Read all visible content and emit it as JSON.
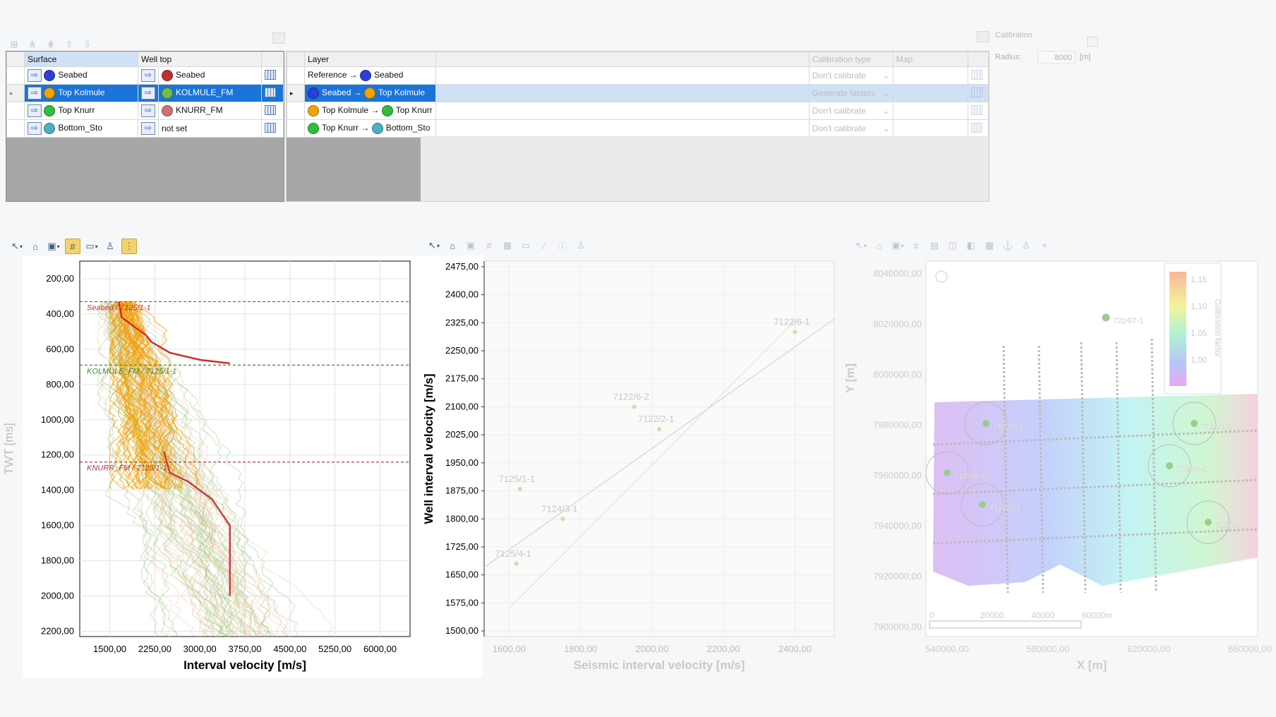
{
  "top_panel": {
    "calibration_label": "Calibration",
    "radius_label": "Radius:",
    "radius_value": "8000",
    "radius_unit": "[m]"
  },
  "surface_grid": {
    "headers": [
      "Surface",
      "Well top"
    ],
    "rows": [
      {
        "surface": "Seabed",
        "well_top": "Seabed",
        "surface_color": "#2d3fd8",
        "top_color": "#c03030"
      },
      {
        "surface": "Top Kolmule",
        "well_top": "KOLMULE_FM",
        "surface_color": "#f2a400",
        "top_color": "#6fbf4a"
      },
      {
        "surface": "Top Knurr",
        "well_top": "KNURR_FM",
        "surface_color": "#2fbf3a",
        "top_color": "#d07070"
      },
      {
        "surface": "Bottom_Sto",
        "well_top": "not set",
        "surface_color": "#4ab0c8",
        "top_color": ""
      }
    ]
  },
  "layer_grid": {
    "headers": [
      "Layer",
      "Calibration type",
      "Map"
    ],
    "rows": [
      {
        "from": "Reference",
        "to": "Seabed",
        "calibration": "Don't calibrate"
      },
      {
        "from": "Seabed",
        "to": "Top Kolmule",
        "calibration": "Generate factors"
      },
      {
        "from": "Top Kolmule",
        "to": "Top Knurr",
        "calibration": "Don't calibrate"
      },
      {
        "from": "Top Knurr",
        "to": "Bottom_Sto",
        "calibration": "Don't calibrate"
      }
    ]
  },
  "chart_data": [
    {
      "type": "line",
      "xlabel": "Interval velocity [m/s]",
      "ylabel": "TWT [ms]",
      "xticks": [
        "1500,00",
        "2250,00",
        "3000,00",
        "3750,00",
        "4500,00",
        "5250,00",
        "6000,00"
      ],
      "yticks": [
        "200,00",
        "400,00",
        "600,00",
        "800,00",
        "1000,00",
        "1200,00",
        "1400,00",
        "1600,00",
        "1800,00",
        "2000,00",
        "2200,00"
      ],
      "xlim": [
        1000,
        6500
      ],
      "ylim": [
        100,
        2230
      ],
      "annotations": [
        {
          "label": "Seabed / 7125/1-1",
          "y": 330,
          "color": "#c0392b"
        },
        {
          "label": "KOLMULE_FM / 7125/1-1",
          "y": 690,
          "color": "#3a8a3a"
        },
        {
          "label": "KNURR_FM / 7125/1-1",
          "y": 1240,
          "color": "#a04050"
        }
      ],
      "series": [
        {
          "values": [
            [
              1650,
              330
            ],
            [
              1700,
              420
            ],
            [
              1900,
              470
            ],
            [
              2100,
              520
            ],
            [
              2200,
              560
            ],
            [
              2500,
              620
            ],
            [
              3000,
              660
            ],
            [
              3500,
              680
            ]
          ]
        },
        {
          "values": [
            [
              2400,
              1180
            ],
            [
              2500,
              1300
            ],
            [
              2800,
              1350
            ],
            [
              3000,
              1400
            ],
            [
              3200,
              1450
            ],
            [
              3300,
              1500
            ],
            [
              3400,
              1550
            ],
            [
              3500,
              1600
            ],
            [
              3500,
              2000
            ]
          ]
        }
      ]
    },
    {
      "type": "scatter",
      "xlabel": "Seismic interval velocity [m/s]",
      "ylabel": "Well interval velocity [m/s]",
      "xticks": [
        "1600,00",
        "1800,00",
        "2000,00",
        "2200,00",
        "2400,00"
      ],
      "yticks": [
        "2475,00",
        "2400,00",
        "2325,00",
        "2250,00",
        "2175,00",
        "2100,00",
        "2025,00",
        "1950,00",
        "1875,00",
        "1800,00",
        "1725,00",
        "1650,00",
        "1575,00",
        "1500,00"
      ],
      "xlim": [
        1530,
        2510
      ],
      "ylim": [
        1485,
        2490
      ],
      "points": [
        {
          "label": "7122/6-1",
          "x": 2400,
          "y": 2300
        },
        {
          "label": "7122/6-2",
          "x": 1950,
          "y": 2100
        },
        {
          "label": "7122/2-1",
          "x": 2020,
          "y": 2040
        },
        {
          "label": "7125/1-1",
          "x": 1630,
          "y": 1880
        },
        {
          "label": "7124/3-1",
          "x": 1750,
          "y": 1800
        },
        {
          "label": "7125/4-1",
          "x": 1620,
          "y": 1680
        }
      ]
    },
    {
      "type": "heatmap",
      "xlabel": "X [m]",
      "ylabel": "Y [m]",
      "xticks": [
        "540000,00",
        "580000,00",
        "620000,00",
        "660000,00"
      ],
      "yticks": [
        "8040000,00",
        "8020000,00",
        "8000000,00",
        "7980000,00",
        "7960000,00",
        "7940000,00",
        "7920000,00",
        "7900000,00"
      ],
      "legend_title": "Calibration factor",
      "legend_ticks": [
        "1,15",
        "1,10",
        "1,05",
        "1,00"
      ],
      "scalebar": [
        "0",
        "20000",
        "40000",
        "60000m"
      ],
      "wells": [
        "7224/7-1",
        "7122/6-1",
        "7125/1-1",
        "7125/4-1",
        "7122/6-2",
        "7122/2-1",
        "7124/3-1"
      ]
    }
  ]
}
